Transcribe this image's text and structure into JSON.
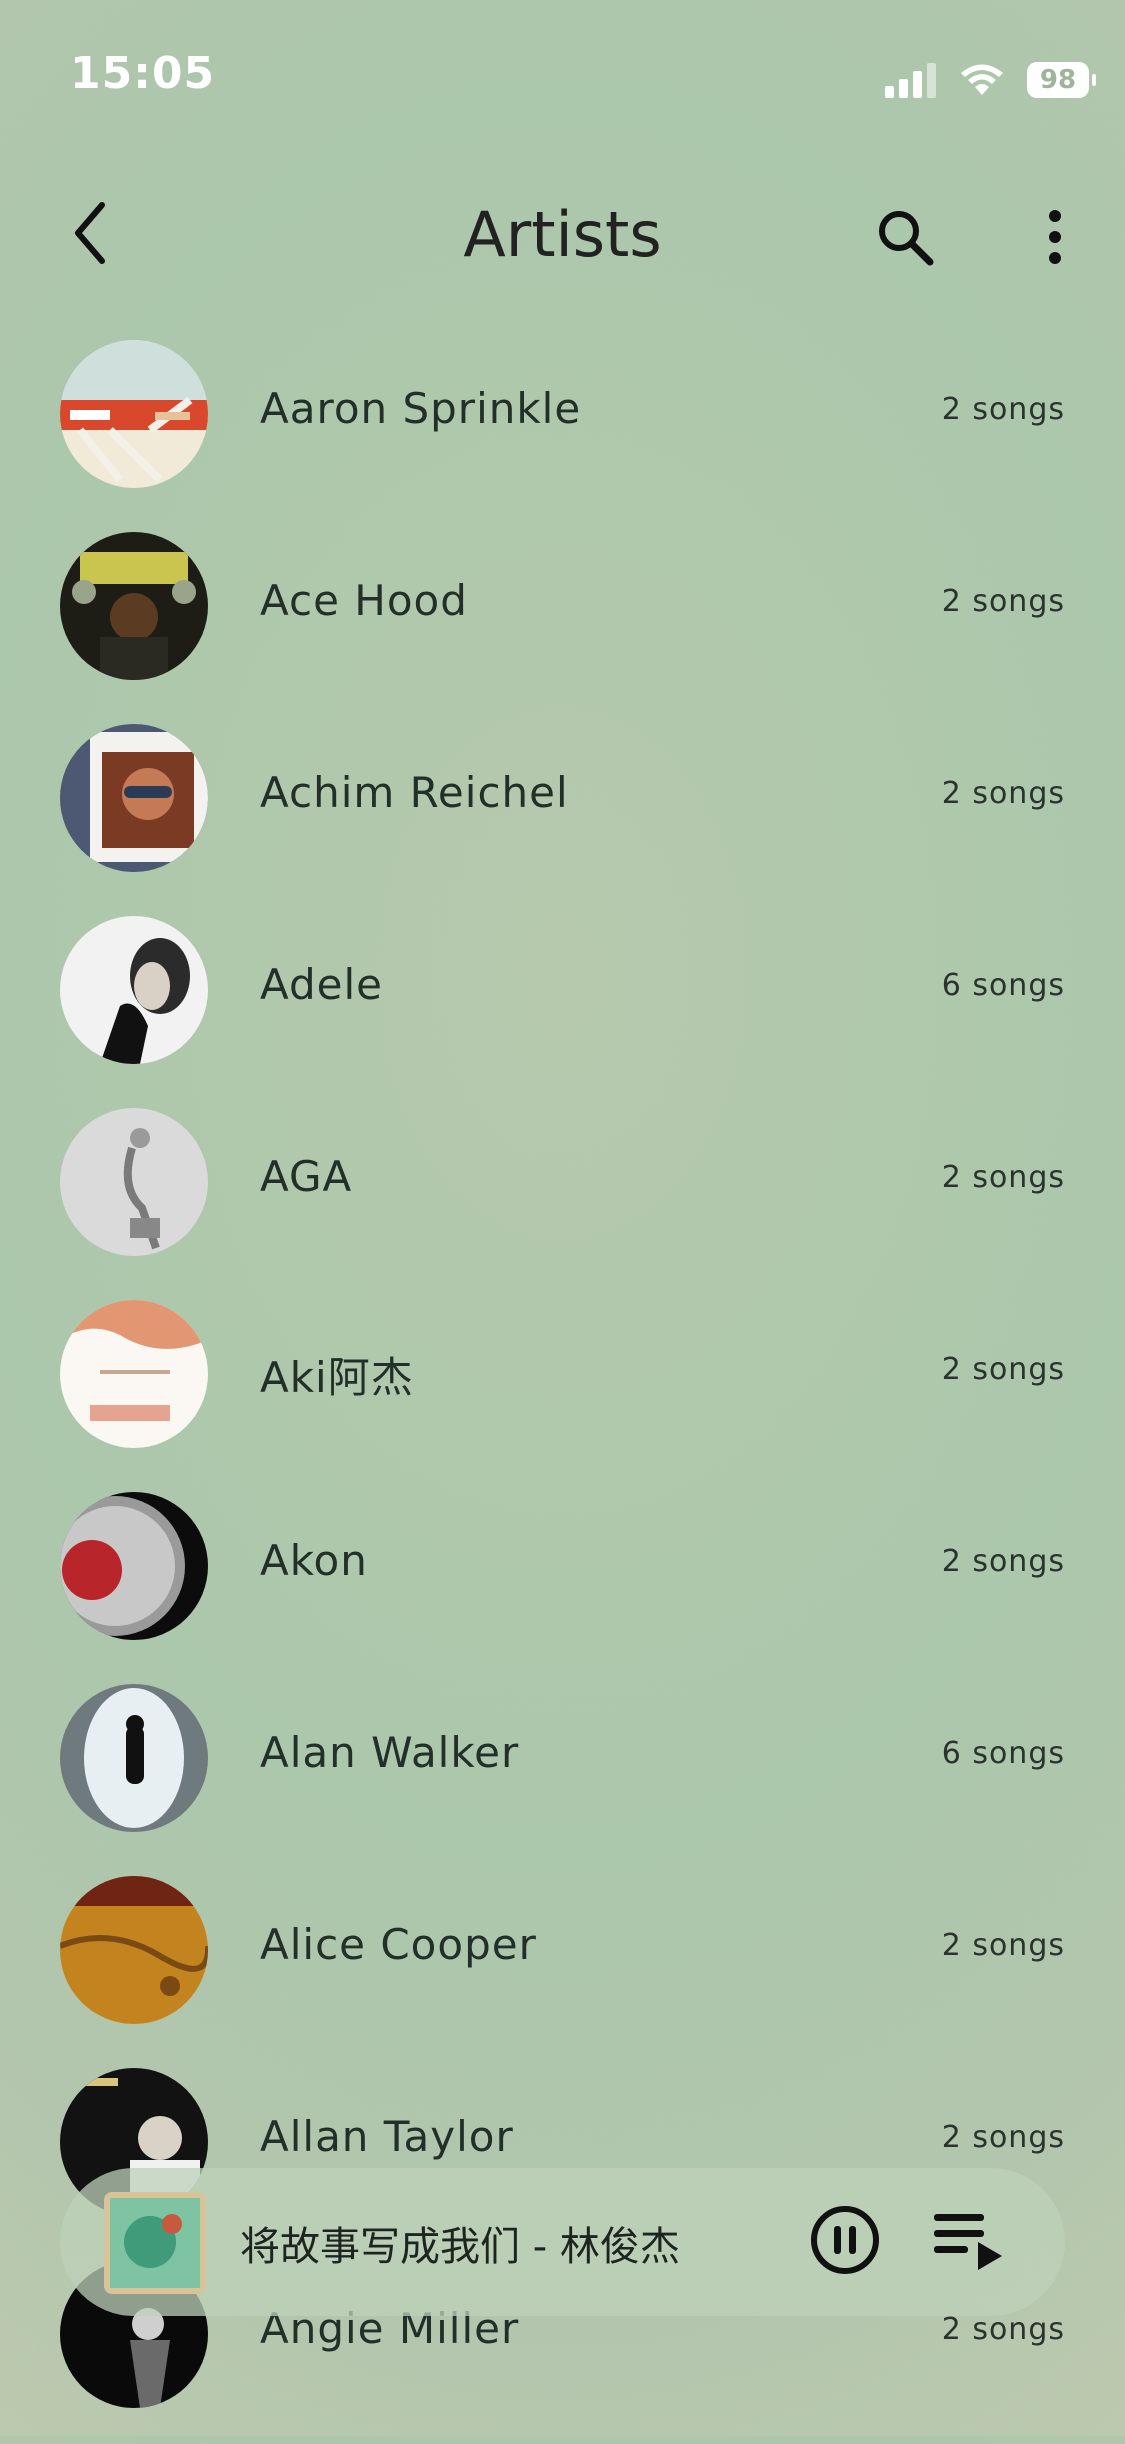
{
  "status_bar": {
    "time": "15:05",
    "battery": "98"
  },
  "header": {
    "title": "Artists"
  },
  "artists": [
    {
      "name": "Aaron Sprinkle",
      "count": "2 songs"
    },
    {
      "name": "Ace Hood",
      "count": "2 songs"
    },
    {
      "name": "Achim Reichel",
      "count": "2 songs"
    },
    {
      "name": "Adele",
      "count": "6 songs"
    },
    {
      "name": "AGA",
      "count": "2 songs"
    },
    {
      "name": "Aki阿杰",
      "count": "2 songs"
    },
    {
      "name": "Akon",
      "count": "2 songs"
    },
    {
      "name": "Alan Walker",
      "count": "6 songs"
    },
    {
      "name": "Alice Cooper",
      "count": "2 songs"
    },
    {
      "name": "Allan Taylor",
      "count": "2 songs"
    },
    {
      "name": "Angie Miller",
      "count": "2 songs"
    }
  ],
  "now_playing": {
    "track": "将故事写成我们 - 林俊杰"
  }
}
